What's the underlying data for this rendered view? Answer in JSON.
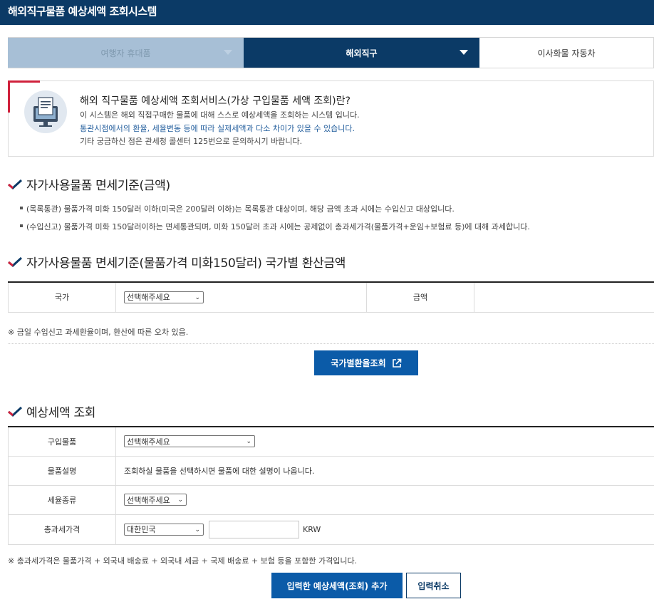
{
  "header": {
    "title": "해외직구물품 예상세액 조회시스템"
  },
  "tabs": [
    {
      "label": "여행자 휴대품"
    },
    {
      "label": "해외직구"
    },
    {
      "label": "이사화물 자동차"
    }
  ],
  "intro": {
    "heading": "해외 직구물품 예상세액 조회서비스(가상 구입물품 세액 조회)란?",
    "line1": "이 시스템은 해외 직접구매한 물품에 대해 스스로 예상세액을 조회하는 시스템 입니다.",
    "line2": "통관시점에서의 환율, 세율변동 등에 따라 실제세액과 다소 차이가 있을 수 있습니다.",
    "line3": "기타 궁금하신 점은 관세청 콜센터 125번으로 문의하시기 바랍니다."
  },
  "section1": {
    "title": "자가사용물품 면세기준(금액)",
    "bullets": [
      "(목록통관) 물품가격 미화 150달러 이하(미국은 200달러 이하)는 목록통관 대상이며, 해당 금액 초과 시에는 수입신고 대상입니다.",
      "(수입신고) 물품가격 미화 150달러이하는 면세통관되며, 미화 150달러 초과 시에는 공제없이 총과세가격(물품가격+운임+보험료 등)에 대해 과세합니다."
    ]
  },
  "section2": {
    "title": "자가사용물품 면세기준(물품가격 미화150달러) 국가별 환산금액",
    "country_label": "국가",
    "country_select": "선택해주세요",
    "amount_label": "금액",
    "note": "※  금일 수입신고 과세환율이며, 환산에 따른 오차 있음.",
    "button": "국가별환율조회"
  },
  "section3": {
    "title": "예상세액 조회",
    "rows": {
      "item_label": "구입물품",
      "item_select": "선택해주세요",
      "desc_label": "물품설명",
      "desc_text": "조회하실 물품을 선택하시면 물품에 대한 설명이 나옵니다.",
      "taxtype_label": "세율종류",
      "taxtype_select": "선택해주세요",
      "total_label": "총과세가격",
      "total_country": "대한민국",
      "total_value": "",
      "currency": "KRW"
    },
    "note": "※  총과세가격은 물품가격 + 외국내 배송료 + 외국내 세금 + 국제 배송료 + 보험 등을 포함한 가격입니다.",
    "add_button": "입력한 예상세액(조회) 추가",
    "cancel_button": "입력취소"
  },
  "colors": {
    "navy": "#0b3a66",
    "button_blue": "#0b5ba8",
    "accent_red": "#d0213c"
  }
}
